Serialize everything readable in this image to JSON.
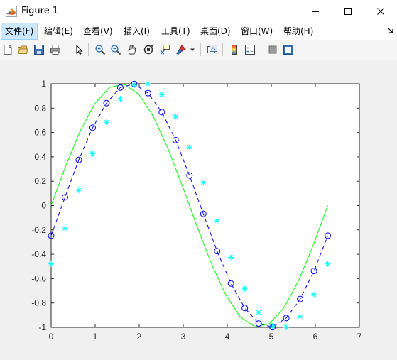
{
  "window": {
    "title": "Figure 1",
    "minimize_icon": "minimize-icon",
    "maximize_icon": "maximize-icon",
    "close_icon": "close-icon"
  },
  "menubar": {
    "items": [
      {
        "label": "文件(F)",
        "active": true
      },
      {
        "label": "编辑(E)"
      },
      {
        "label": "查看(V)"
      },
      {
        "label": "插入(I)"
      },
      {
        "label": "工具(T)"
      },
      {
        "label": "桌面(D)"
      },
      {
        "label": "窗口(W)"
      },
      {
        "label": "帮助(H)"
      }
    ],
    "overflow_icon": "menu-dock-arrow-icon"
  },
  "toolbar": {
    "buttons": [
      "new-figure-icon",
      "open-file-icon",
      "save-figure-icon",
      "print-figure-icon",
      "edit-plot-icon",
      "zoom-in-icon",
      "zoom-out-icon",
      "pan-icon",
      "rotate-3d-icon",
      "data-cursor-icon",
      "brush-icon",
      "brush-dropdown-icon",
      "link-plot-icon",
      "insert-colorbar-icon",
      "insert-legend-icon",
      "hide-plot-tools-icon",
      "show-plot-tools-icon"
    ]
  },
  "chart_data": {
    "type": "line",
    "title": "",
    "xlabel": "",
    "ylabel": "",
    "xlim": [
      0,
      7
    ],
    "ylim": [
      -1,
      1
    ],
    "xticks": [
      "0",
      "1",
      "2",
      "3",
      "4",
      "5",
      "6",
      "7"
    ],
    "yticks": [
      "1",
      "0.8",
      "0.6",
      "0.4",
      "0.2",
      "0",
      "-0.2",
      "-0.4",
      "-0.6",
      "-0.8",
      "-1"
    ],
    "grid": false,
    "legend": "none",
    "series": [
      {
        "style": "solid line",
        "color": "#00ff00",
        "x": [
          0,
          0.3307,
          0.6614,
          0.9921,
          1.3228,
          1.6535,
          1.9842,
          2.3149,
          2.6456,
          2.9762,
          3.3069,
          3.6376,
          3.9683,
          4.299,
          4.6297,
          4.9604,
          5.2911,
          5.6218,
          5.9525,
          6.2832
        ],
        "y": [
          0,
          0.3247,
          0.6142,
          0.837,
          0.9694,
          0.9966,
          0.9158,
          0.7357,
          0.4759,
          0.1646,
          -0.1646,
          -0.4759,
          -0.7357,
          -0.9158,
          -0.9966,
          -0.9694,
          -0.837,
          -0.6142,
          -0.3247,
          0
        ]
      },
      {
        "style": "dashed line with circle markers",
        "color": "#0000ff",
        "x": [
          0,
          0.3142,
          0.6283,
          0.9425,
          1.2566,
          1.5708,
          1.885,
          2.1991,
          2.5133,
          2.8274,
          3.1416,
          3.4558,
          3.7699,
          4.0841,
          4.3982,
          4.7124,
          5.0265,
          5.3407,
          5.6549,
          5.969,
          6.2832
        ],
        "y": [
          -0.2474,
          0.0678,
          0.3752,
          0.6397,
          0.8414,
          0.9689,
          0.9985,
          0.9232,
          0.7674,
          0.5372,
          0.2474,
          -0.0678,
          -0.3752,
          -0.6397,
          -0.8414,
          -0.9689,
          -0.9985,
          -0.9232,
          -0.7674,
          -0.5372,
          -0.2474
        ]
      },
      {
        "style": "asterisk markers",
        "color": "#00ffff",
        "x": [
          0,
          0.3142,
          0.6283,
          0.9425,
          1.2566,
          1.5708,
          1.885,
          2.1991,
          2.5133,
          2.8274,
          3.1416,
          3.4558,
          3.7699,
          4.0841,
          4.3982,
          4.7124,
          5.0265,
          5.3407,
          5.6549,
          5.969,
          6.2832
        ],
        "y": [
          -0.4794,
          -0.1891,
          0.1253,
          0.4251,
          0.6839,
          0.8776,
          0.9887,
          1.0,
          0.9111,
          0.7301,
          0.4794,
          0.1891,
          -0.1253,
          -0.4251,
          -0.6839,
          -0.8776,
          -0.9887,
          -1.0,
          -0.9111,
          -0.7301,
          -0.4794
        ]
      }
    ]
  }
}
